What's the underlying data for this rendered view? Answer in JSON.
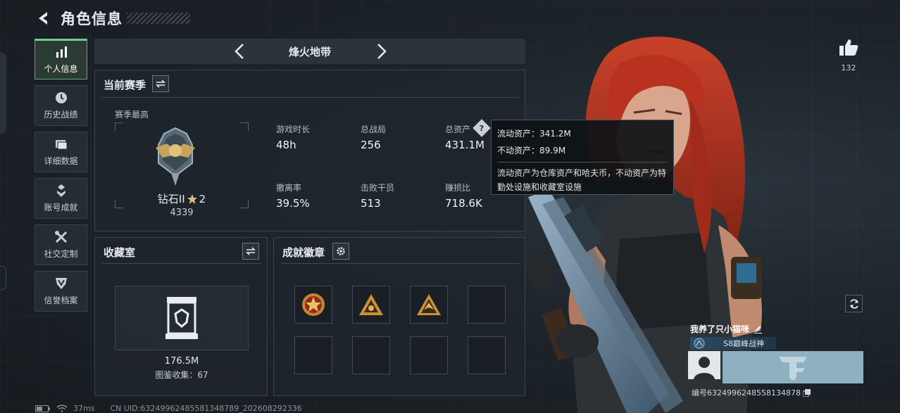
{
  "header": {
    "title": "角色信息"
  },
  "sidebar": {
    "items": [
      {
        "label": "个人信息",
        "icon": "bar-chart-icon",
        "active": true
      },
      {
        "label": "历史战绩",
        "icon": "history-icon",
        "active": false
      },
      {
        "label": "详细数据",
        "icon": "folder-icon",
        "active": false
      },
      {
        "label": "账号成就",
        "icon": "achievement-icon",
        "active": false
      },
      {
        "label": "社交定制",
        "icon": "tools-icon",
        "active": false
      },
      {
        "label": "信誉档案",
        "icon": "credit-icon",
        "active": false
      }
    ]
  },
  "mode": {
    "title": "烽火地带"
  },
  "season": {
    "title": "当前赛季",
    "peak_label": "赛季最高",
    "rank_name": "钻石II",
    "rank_stars": "2",
    "rank_score": "4339",
    "stats": [
      {
        "label": "游戏时长",
        "value": "48h"
      },
      {
        "label": "总战局",
        "value": "256"
      },
      {
        "label": "总资产",
        "value": "431.1M"
      },
      {
        "label": "撤离率",
        "value": "39.5%"
      },
      {
        "label": "击败干员",
        "value": "513"
      },
      {
        "label": "赚损比",
        "value": "718.6K"
      }
    ]
  },
  "tooltip": {
    "liquid": "流动资产：341.2M",
    "fixed": "不动资产：89.9M",
    "description": "流动资产为仓库资产和哈夫币，不动资产为特勤处设施和收藏室设施"
  },
  "collection": {
    "title": "收藏室",
    "value": "176.5M",
    "count_text": "图鉴收集：67"
  },
  "badges": {
    "title": "成就徽章",
    "slots": [
      "red-star-badge",
      "triangle-badge",
      "eagle-triangle-badge",
      "",
      "",
      "",
      "",
      ""
    ]
  },
  "profile": {
    "likes": "132",
    "player_name": "我养了只小猫咪",
    "title": "S8巅峰战神",
    "id_text": "编号6324996248558134878"
  },
  "status": {
    "ping": "37ms",
    "uid": "CN UID:6324996248558134878​9_202608292336"
  },
  "colors": {
    "accent": "#6fcf8e",
    "panel": "#1e252b",
    "hair": "#b8321f"
  }
}
